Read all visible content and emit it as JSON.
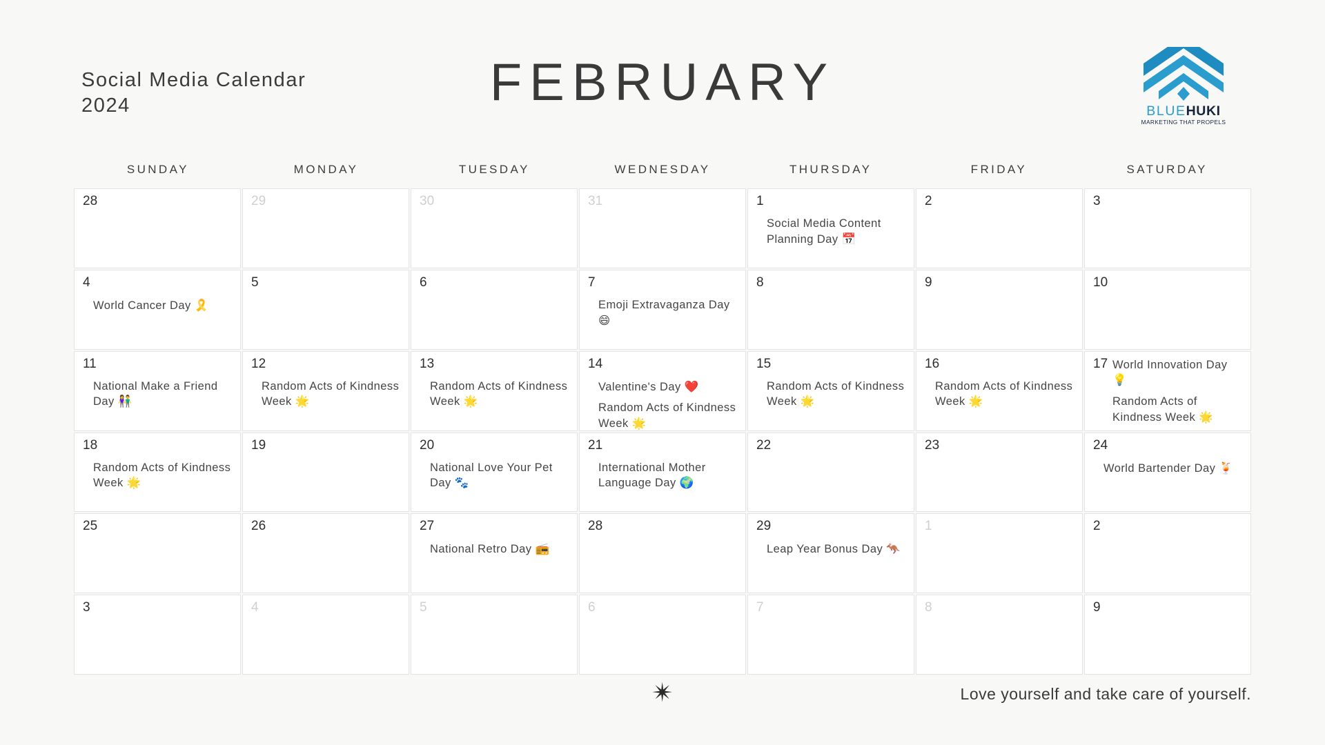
{
  "header": {
    "title_line1": "Social Media Calendar",
    "title_line2": "2024",
    "month": "FEBRUARY"
  },
  "logo": {
    "name_part1": "BLUE",
    "name_part2": "HUKI",
    "tagline": "MARKETING THAT PROPELS",
    "mark_color": "#2a9ccd",
    "text_color": "#17243d"
  },
  "weekdays": [
    "SUNDAY",
    "MONDAY",
    "TUESDAY",
    "WEDNESDAY",
    "THURSDAY",
    "FRIDAY",
    "SATURDAY"
  ],
  "days": [
    {
      "num": "28",
      "out": false,
      "inline": false,
      "events": []
    },
    {
      "num": "29",
      "out": true,
      "inline": false,
      "events": []
    },
    {
      "num": "30",
      "out": true,
      "inline": false,
      "events": []
    },
    {
      "num": "31",
      "out": true,
      "inline": false,
      "events": []
    },
    {
      "num": "1",
      "out": false,
      "inline": false,
      "events": [
        {
          "text": "Social Media Content Planning Day",
          "emoji": "📅",
          "emoji_name": "calendar-emoji"
        }
      ]
    },
    {
      "num": "2",
      "out": false,
      "inline": false,
      "events": []
    },
    {
      "num": "3",
      "out": false,
      "inline": false,
      "events": []
    },
    {
      "num": "4",
      "out": false,
      "inline": false,
      "events": [
        {
          "text": "World Cancer Day",
          "emoji": "🎗️",
          "emoji_name": "ribbon-emoji"
        }
      ]
    },
    {
      "num": "5",
      "out": false,
      "inline": false,
      "events": []
    },
    {
      "num": "6",
      "out": false,
      "inline": false,
      "events": []
    },
    {
      "num": "7",
      "out": false,
      "inline": false,
      "events": [
        {
          "text": "Emoji Extravaganza Day",
          "emoji": "😄",
          "emoji_name": "grinning-face-emoji"
        }
      ]
    },
    {
      "num": "8",
      "out": false,
      "inline": false,
      "events": []
    },
    {
      "num": "9",
      "out": false,
      "inline": false,
      "events": []
    },
    {
      "num": "10",
      "out": false,
      "inline": false,
      "events": []
    },
    {
      "num": "11",
      "out": false,
      "inline": false,
      "events": [
        {
          "text": "National Make a Friend Day",
          "emoji": "👫",
          "emoji_name": "couple-emoji"
        }
      ]
    },
    {
      "num": "12",
      "out": false,
      "inline": false,
      "events": [
        {
          "text": "Random Acts of Kindness Week",
          "emoji": "🌟",
          "emoji_name": "glowing-star-emoji"
        }
      ]
    },
    {
      "num": "13",
      "out": false,
      "inline": false,
      "events": [
        {
          "text": "Random Acts of Kindness Week",
          "emoji": "🌟",
          "emoji_name": "glowing-star-emoji"
        }
      ]
    },
    {
      "num": "14",
      "out": false,
      "inline": false,
      "events": [
        {
          "text": "Valentine's Day",
          "emoji": "❤️",
          "emoji_name": "red-heart-emoji"
        },
        {
          "text": "Random Acts of Kindness Week",
          "emoji": "🌟",
          "emoji_name": "glowing-star-emoji"
        }
      ]
    },
    {
      "num": "15",
      "out": false,
      "inline": false,
      "events": [
        {
          "text": "Random Acts of Kindness Week",
          "emoji": "🌟",
          "emoji_name": "glowing-star-emoji"
        }
      ]
    },
    {
      "num": "16",
      "out": false,
      "inline": false,
      "events": [
        {
          "text": "Random Acts of Kindness Week",
          "emoji": "🌟",
          "emoji_name": "glowing-star-emoji"
        }
      ]
    },
    {
      "num": "17",
      "out": false,
      "inline": true,
      "events": [
        {
          "text": "World Innovation Day",
          "emoji": "💡",
          "emoji_name": "light-bulb-emoji"
        },
        {
          "text": "Random Acts of Kindness Week",
          "emoji": "🌟",
          "emoji_name": "glowing-star-emoji"
        }
      ]
    },
    {
      "num": "18",
      "out": false,
      "inline": false,
      "events": [
        {
          "text": "Random Acts of Kindness Week",
          "emoji": "🌟",
          "emoji_name": "glowing-star-emoji"
        }
      ]
    },
    {
      "num": "19",
      "out": false,
      "inline": false,
      "events": []
    },
    {
      "num": "20",
      "out": false,
      "inline": false,
      "events": [
        {
          "text": "National Love Your Pet Day",
          "emoji": "🐾",
          "emoji_name": "paw-prints-emoji"
        }
      ]
    },
    {
      "num": "21",
      "out": false,
      "inline": false,
      "events": [
        {
          "text": "International Mother Language Day",
          "emoji": "🌍",
          "emoji_name": "globe-emoji"
        }
      ]
    },
    {
      "num": "22",
      "out": false,
      "inline": false,
      "events": []
    },
    {
      "num": "23",
      "out": false,
      "inline": false,
      "events": []
    },
    {
      "num": "24",
      "out": false,
      "inline": false,
      "events": [
        {
          "text": "World Bartender Day",
          "emoji": "🍹",
          "emoji_name": "tropical-drink-emoji"
        }
      ]
    },
    {
      "num": "25",
      "out": false,
      "inline": false,
      "events": []
    },
    {
      "num": "26",
      "out": false,
      "inline": false,
      "events": []
    },
    {
      "num": "27",
      "out": false,
      "inline": false,
      "events": [
        {
          "text": "National Retro Day",
          "emoji": "📻",
          "emoji_name": "radio-emoji"
        }
      ]
    },
    {
      "num": "28",
      "out": false,
      "inline": false,
      "events": []
    },
    {
      "num": "29",
      "out": false,
      "inline": false,
      "events": [
        {
          "text": "Leap Year Bonus Day",
          "emoji": "🦘",
          "emoji_name": "kangaroo-emoji"
        }
      ]
    },
    {
      "num": "1",
      "out": true,
      "inline": false,
      "events": []
    },
    {
      "num": "2",
      "out": false,
      "inline": false,
      "events": []
    },
    {
      "num": "3",
      "out": false,
      "inline": false,
      "events": []
    },
    {
      "num": "4",
      "out": true,
      "inline": false,
      "events": []
    },
    {
      "num": "5",
      "out": true,
      "inline": false,
      "events": []
    },
    {
      "num": "6",
      "out": true,
      "inline": false,
      "events": []
    },
    {
      "num": "7",
      "out": true,
      "inline": false,
      "events": []
    },
    {
      "num": "8",
      "out": true,
      "inline": false,
      "events": []
    },
    {
      "num": "9",
      "out": false,
      "inline": false,
      "events": []
    }
  ],
  "footer": {
    "sparkle": "✴",
    "tagline": "Love yourself and take care of yourself."
  }
}
